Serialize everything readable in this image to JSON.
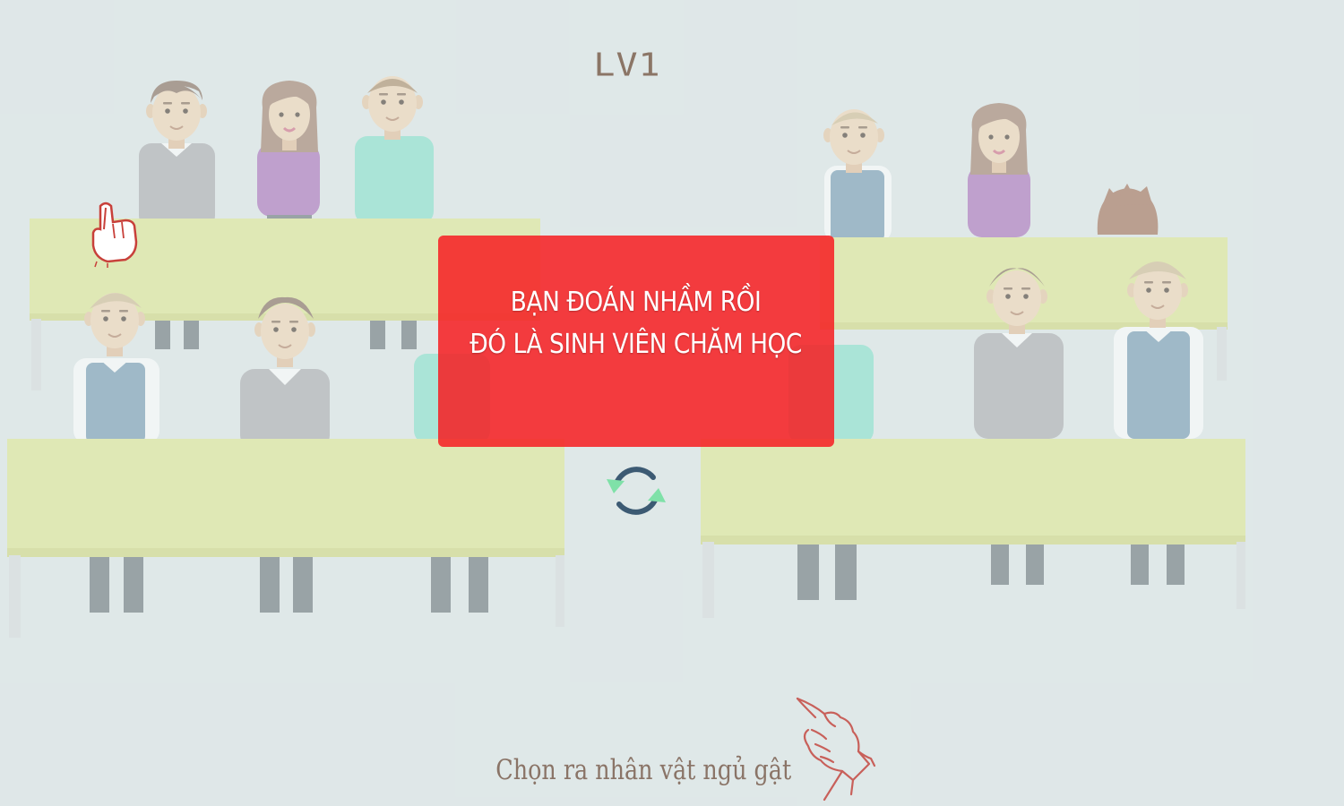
{
  "level": {
    "label": "LV1"
  },
  "popup": {
    "line1": "BẠN ĐOÁN NHẦM RỒI",
    "line2": "ĐÓ LÀ SINH VIÊN CHĂM HỌC"
  },
  "replay_button": {
    "icon": "refresh-icon"
  },
  "instruction": {
    "text": "Chọn ra nhân vật ngủ gật"
  },
  "colors": {
    "background": "#dfe7e8",
    "desk": "#dfe88a",
    "popup": "#f61e22",
    "text_brown": "#8a7467",
    "hand_red": "#c8403a"
  }
}
